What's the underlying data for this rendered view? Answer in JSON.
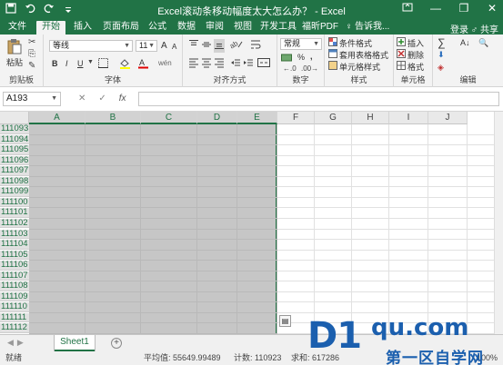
{
  "window": {
    "title": "Excel滚动条移动幅度太大怎么办？ - Excel",
    "minimize_label": "—",
    "restore_label": "❐",
    "close_label": "✕"
  },
  "ribbon_tabs": [
    "文件",
    "开始",
    "插入",
    "页面布局",
    "公式",
    "数据",
    "审阅",
    "视图",
    "开发工具",
    "福昕PDF",
    "♀ 告诉我..."
  ],
  "active_tab": "开始",
  "account": {
    "login": "登录",
    "share": "♂ 共享"
  },
  "ribbon": {
    "clipboard": {
      "paste": "粘贴",
      "label": "剪贴板"
    },
    "font": {
      "name": "等线",
      "size": "11",
      "bold": "B",
      "italic": "I",
      "underline": "U",
      "grow": "A",
      "shrink": "A",
      "label": "字体",
      "wen": "wén"
    },
    "alignment": {
      "label": "对齐方式"
    },
    "number": {
      "format": "常规",
      "percent": "%",
      "comma": ",",
      "label": "数字"
    },
    "styles": {
      "conditional": "条件格式",
      "table": "套用表格格式",
      "cell": "单元格样式",
      "label": "样式"
    },
    "cells": {
      "insert": "插入",
      "delete": "删除",
      "format": "格式",
      "label": "单元格"
    },
    "editing": {
      "sum": "∑",
      "fill": "⬇",
      "clear": "◈",
      "sort": "A↓",
      "find": "🔍",
      "label": "编辑"
    }
  },
  "formula_bar": {
    "name_box": "A193",
    "cancel": "✕",
    "enter": "✓",
    "fx": "fx",
    "formula": ""
  },
  "columns": [
    "A",
    "B",
    "C",
    "D",
    "E",
    "F",
    "G",
    "H",
    "I",
    "J"
  ],
  "selected_columns": [
    "A",
    "B",
    "C",
    "D",
    "E"
  ],
  "rows": [
    "111093",
    "111094",
    "111095",
    "111096",
    "111097",
    "111098",
    "111099",
    "111100",
    "111101",
    "111102",
    "111103",
    "111104",
    "111105",
    "111106",
    "111107",
    "111108",
    "111109",
    "111110",
    "111111",
    "111112"
  ],
  "sheet_tabs": [
    "Sheet1"
  ],
  "status": {
    "mode": "就绪",
    "average": "平均值: 55649.99489",
    "count": "计数: 110923",
    "sum": "求和: 617286",
    "zoom": "100%"
  },
  "watermark": {
    "logo": "D1",
    "domain": "qu.com",
    "cn": "第一区自学网"
  },
  "colors": {
    "accent": "#217346",
    "selection": "#c6c6c6",
    "watermark": "#1b5fae"
  }
}
